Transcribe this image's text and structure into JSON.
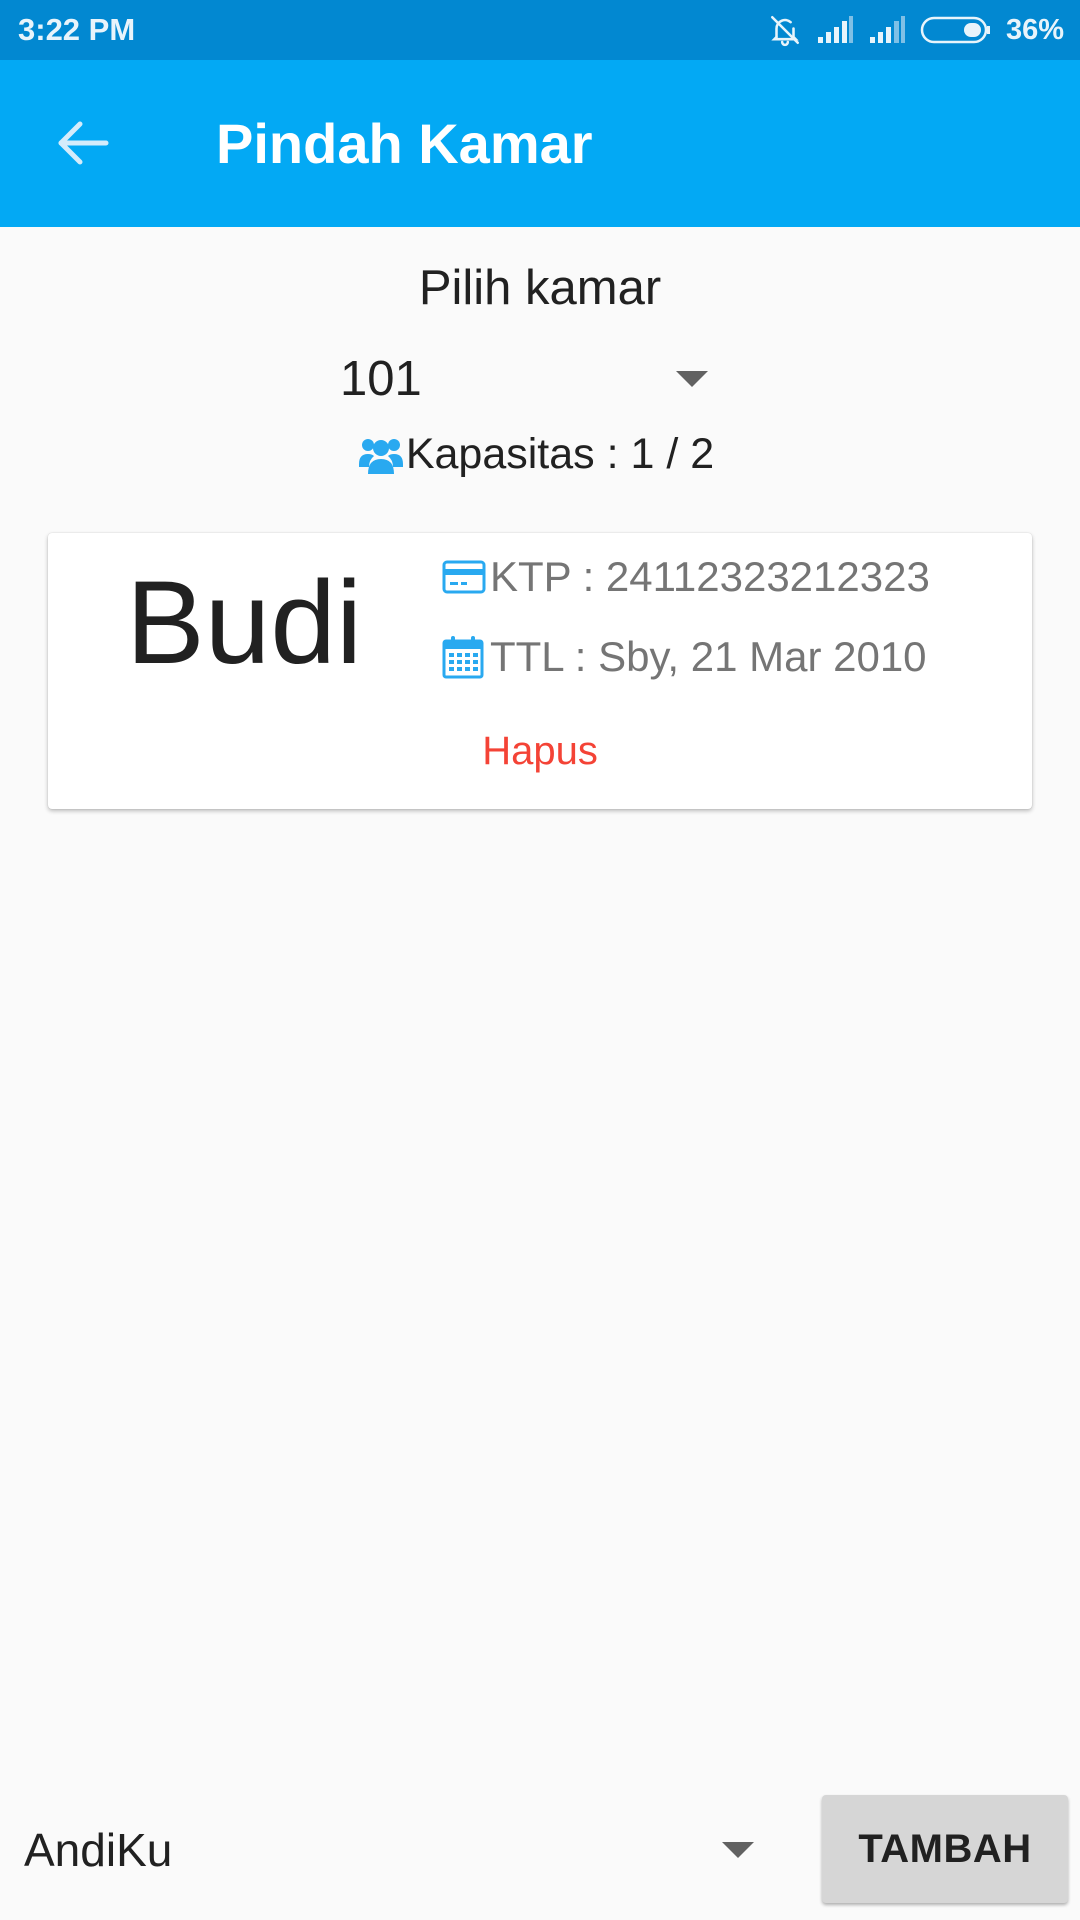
{
  "status_bar": {
    "time": "3:22 PM",
    "battery": "36%",
    "icons": [
      "bell-off-icon",
      "signal-icon",
      "signal-icon",
      "battery-icon"
    ]
  },
  "app_bar": {
    "title": "Pindah Kamar",
    "back_icon": "arrow-left-icon",
    "color": "#03a9f4"
  },
  "room_selector": {
    "label": "Pilih kamar",
    "selected": "101",
    "capacity_text": "Kapasitas : 1 / 2",
    "capacity_icon": "users-icon"
  },
  "occupant_card": {
    "name": "Budi",
    "ktp_text": "KTP : 24112323212323",
    "ktp_icon": "id-card-icon",
    "ttl_text": "TTL : Sby, 21 Mar 2010",
    "ttl_icon": "calendar-icon",
    "delete_label": "Hapus",
    "delete_color": "#f44336"
  },
  "add_occupant": {
    "selected": "AndiKu",
    "add_label": "TAMBAH"
  },
  "colors": {
    "accent": "#03a9f4",
    "status_bar": "#0288d1",
    "icon_blue": "#29a9f0"
  }
}
